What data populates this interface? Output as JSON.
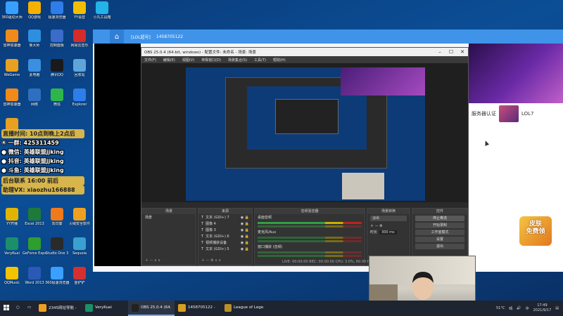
{
  "desktop": {
    "icons": [
      {
        "label": "360驱动大师",
        "color": "#3aa0ff"
      },
      {
        "label": "QQ游戏",
        "color": "#f5b000"
      },
      {
        "label": "极速浏览器",
        "color": "#2f7de8"
      },
      {
        "label": "YY语音",
        "color": "#f0c000"
      },
      {
        "label": "小丸工具箱",
        "color": "#23b3e8"
      },
      {
        "label": "雷神加速器",
        "color": "#f08a1a"
      },
      {
        "label": "鲁大师",
        "color": "#2e8fe0"
      },
      {
        "label": "控制面板",
        "color": "#3a6cc9"
      },
      {
        "label": "网易云音乐",
        "color": "#d42b2b"
      },
      {
        "label": "WeGame",
        "color": "#e8a020"
      },
      {
        "label": "此电脑",
        "color": "#3a8fe0"
      },
      {
        "label": "腾讯QQ",
        "color": "#1a1a1a"
      },
      {
        "label": "回收站",
        "color": "#5fa5d9"
      },
      {
        "label": "雷神加速器",
        "color": "#f08a1a"
      },
      {
        "label": "网络",
        "color": "#2f6fbf"
      },
      {
        "label": "微信",
        "color": "#2fb64a"
      },
      {
        "label": "Explorer",
        "color": "#2f7de8"
      },
      {
        "label": "WeGame_V",
        "color": "#e8a020"
      },
      {
        "label": "YY开播",
        "color": "#e0b400"
      },
      {
        "label": "Excel 2013",
        "color": "#1e7a3a"
      },
      {
        "label": "向日葵",
        "color": "#f07a1a"
      },
      {
        "label": "火绒安全软件",
        "color": "#f0a020"
      },
      {
        "label": "VeryKuai",
        "color": "#1a8f6a"
      },
      {
        "label": "GeForce Experience",
        "color": "#2e9e2e"
      },
      {
        "label": "Studio One 3",
        "color": "#2a2a2a"
      },
      {
        "label": "Sequoia",
        "color": "#3aa0d0"
      },
      {
        "label": "QQMusic",
        "color": "#f5c400"
      },
      {
        "label": "Word 2013",
        "color": "#2a5ab5"
      },
      {
        "label": "360极速浏览器",
        "color": "#3aa0ff"
      },
      {
        "label": "金铲铲",
        "color": "#d43030"
      }
    ]
  },
  "overlay": {
    "lines": [
      "直播时间: 10点到晚上2点后",
      "④ 一群: 425311459",
      "● 微信: 英雄联盟jjking",
      "● 抖音: 英雄联盟jjking",
      "● 斗鱼: 英雄联盟jjking",
      "后台联系 16:00 前后",
      "助理VX: xiaozhu166888"
    ]
  },
  "lol_client": {
    "title": "[LOL超号]",
    "subtitle": "1458705122",
    "home_icon": "home-icon",
    "strip_text": "服务器认证",
    "strip_tag": "LOL7",
    "cursor": "mouse-cursor"
  },
  "obs": {
    "title": "OBS 25.0.4 (64-bit, windows) - 配置文件: 未命名 - 场景: 场景",
    "menu": [
      "文件(F)",
      "编辑(E)",
      "视图(V)",
      "停靠窗口(D)",
      "场景集合(S)",
      "工具(T)",
      "帮助(H)"
    ],
    "docks": {
      "scenes": {
        "header": "场景",
        "items": [
          "场景"
        ]
      },
      "sources": {
        "header": "来源",
        "items": [
          "文本 (GDI+) 7",
          "图像 4",
          "图像 3",
          "文本 (GDI+) 6",
          "视频捕获设备",
          "文本 (GDI+) 5"
        ]
      },
      "mixer": {
        "header": "音频混音器",
        "tracks": [
          "桌面音频",
          "麦克风/Aux",
          "窗口捕获 (音频)"
        ]
      },
      "transitions": {
        "header": "场景转换",
        "type": "淡出",
        "duration_label": "时长",
        "duration": "300 ms"
      },
      "controls": {
        "header": "控件",
        "buttons": [
          "停止推流",
          "开始录制",
          "工作室模式",
          "设置",
          "退出"
        ]
      }
    },
    "status": "LIVE: 00:00:00   REC: 00:00:00   CPU: 3.0%, 60.00 fps"
  },
  "promo": {
    "line1": "皮肤",
    "line2": "免费领"
  },
  "taskbar": {
    "items": [
      {
        "label": "2345网址导航 -",
        "icon": "browser-icon",
        "color": "#f0a020"
      },
      {
        "label": "VeryKuai",
        "icon": "verykuai-icon",
        "color": "#1a8f6a"
      },
      {
        "label": "OBS 25.0.4 (64...",
        "icon": "obs-icon",
        "color": "#222222"
      },
      {
        "label": "1458705122 -",
        "icon": "lol-client-icon",
        "color": "#d8a020"
      },
      {
        "label": "League of Lege...",
        "icon": "league-icon",
        "color": "#b8902a"
      }
    ],
    "tray": {
      "temp": "51°C",
      "weather": "晴",
      "lang": "中",
      "time": "17:49",
      "date": "2021/9/17"
    }
  }
}
